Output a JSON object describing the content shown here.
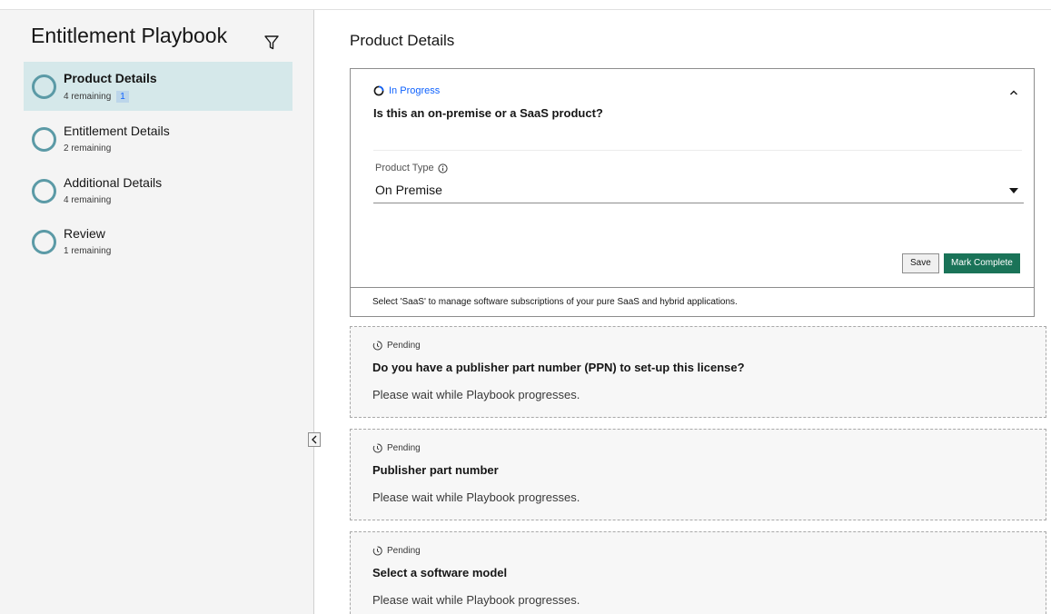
{
  "sidebar": {
    "title": "Entitlement Playbook",
    "steps": [
      {
        "label": "Product Details",
        "remaining": "4 remaining",
        "badge": "1"
      },
      {
        "label": "Entitlement Details",
        "remaining": "2 remaining"
      },
      {
        "label": "Additional Details",
        "remaining": "4 remaining"
      },
      {
        "label": "Review",
        "remaining": "1 remaining"
      }
    ]
  },
  "main": {
    "page_title": "Product Details",
    "active_card": {
      "status": "In Progress",
      "question": "Is this an on-premise or a SaaS product?",
      "field_label": "Product Type",
      "field_value": "On Premise",
      "save_label": "Save",
      "complete_label": "Mark Complete",
      "footer": "Select 'SaaS' to manage software subscriptions of your pure SaaS and hybrid applications."
    },
    "pending_cards": [
      {
        "status": "Pending",
        "title": "Do you have a publisher part number (PPN) to set-up this license?",
        "description": "Please wait while Playbook progresses."
      },
      {
        "status": "Pending",
        "title": "Publisher part number",
        "description": "Please wait while Playbook progresses."
      },
      {
        "status": "Pending",
        "title": "Select a software model",
        "description": "Please wait while Playbook progresses."
      }
    ]
  },
  "colors": {
    "accent": "#0f62fe",
    "primary_button": "#1a7358",
    "step_ring": "#5b9aa6",
    "active_step_bg": "#d5e8ea"
  },
  "icons": [
    "filter-icon",
    "progress-icon",
    "chevron-up-icon",
    "info-icon",
    "caret-down-icon",
    "clock-icon",
    "chevron-left-icon"
  ]
}
